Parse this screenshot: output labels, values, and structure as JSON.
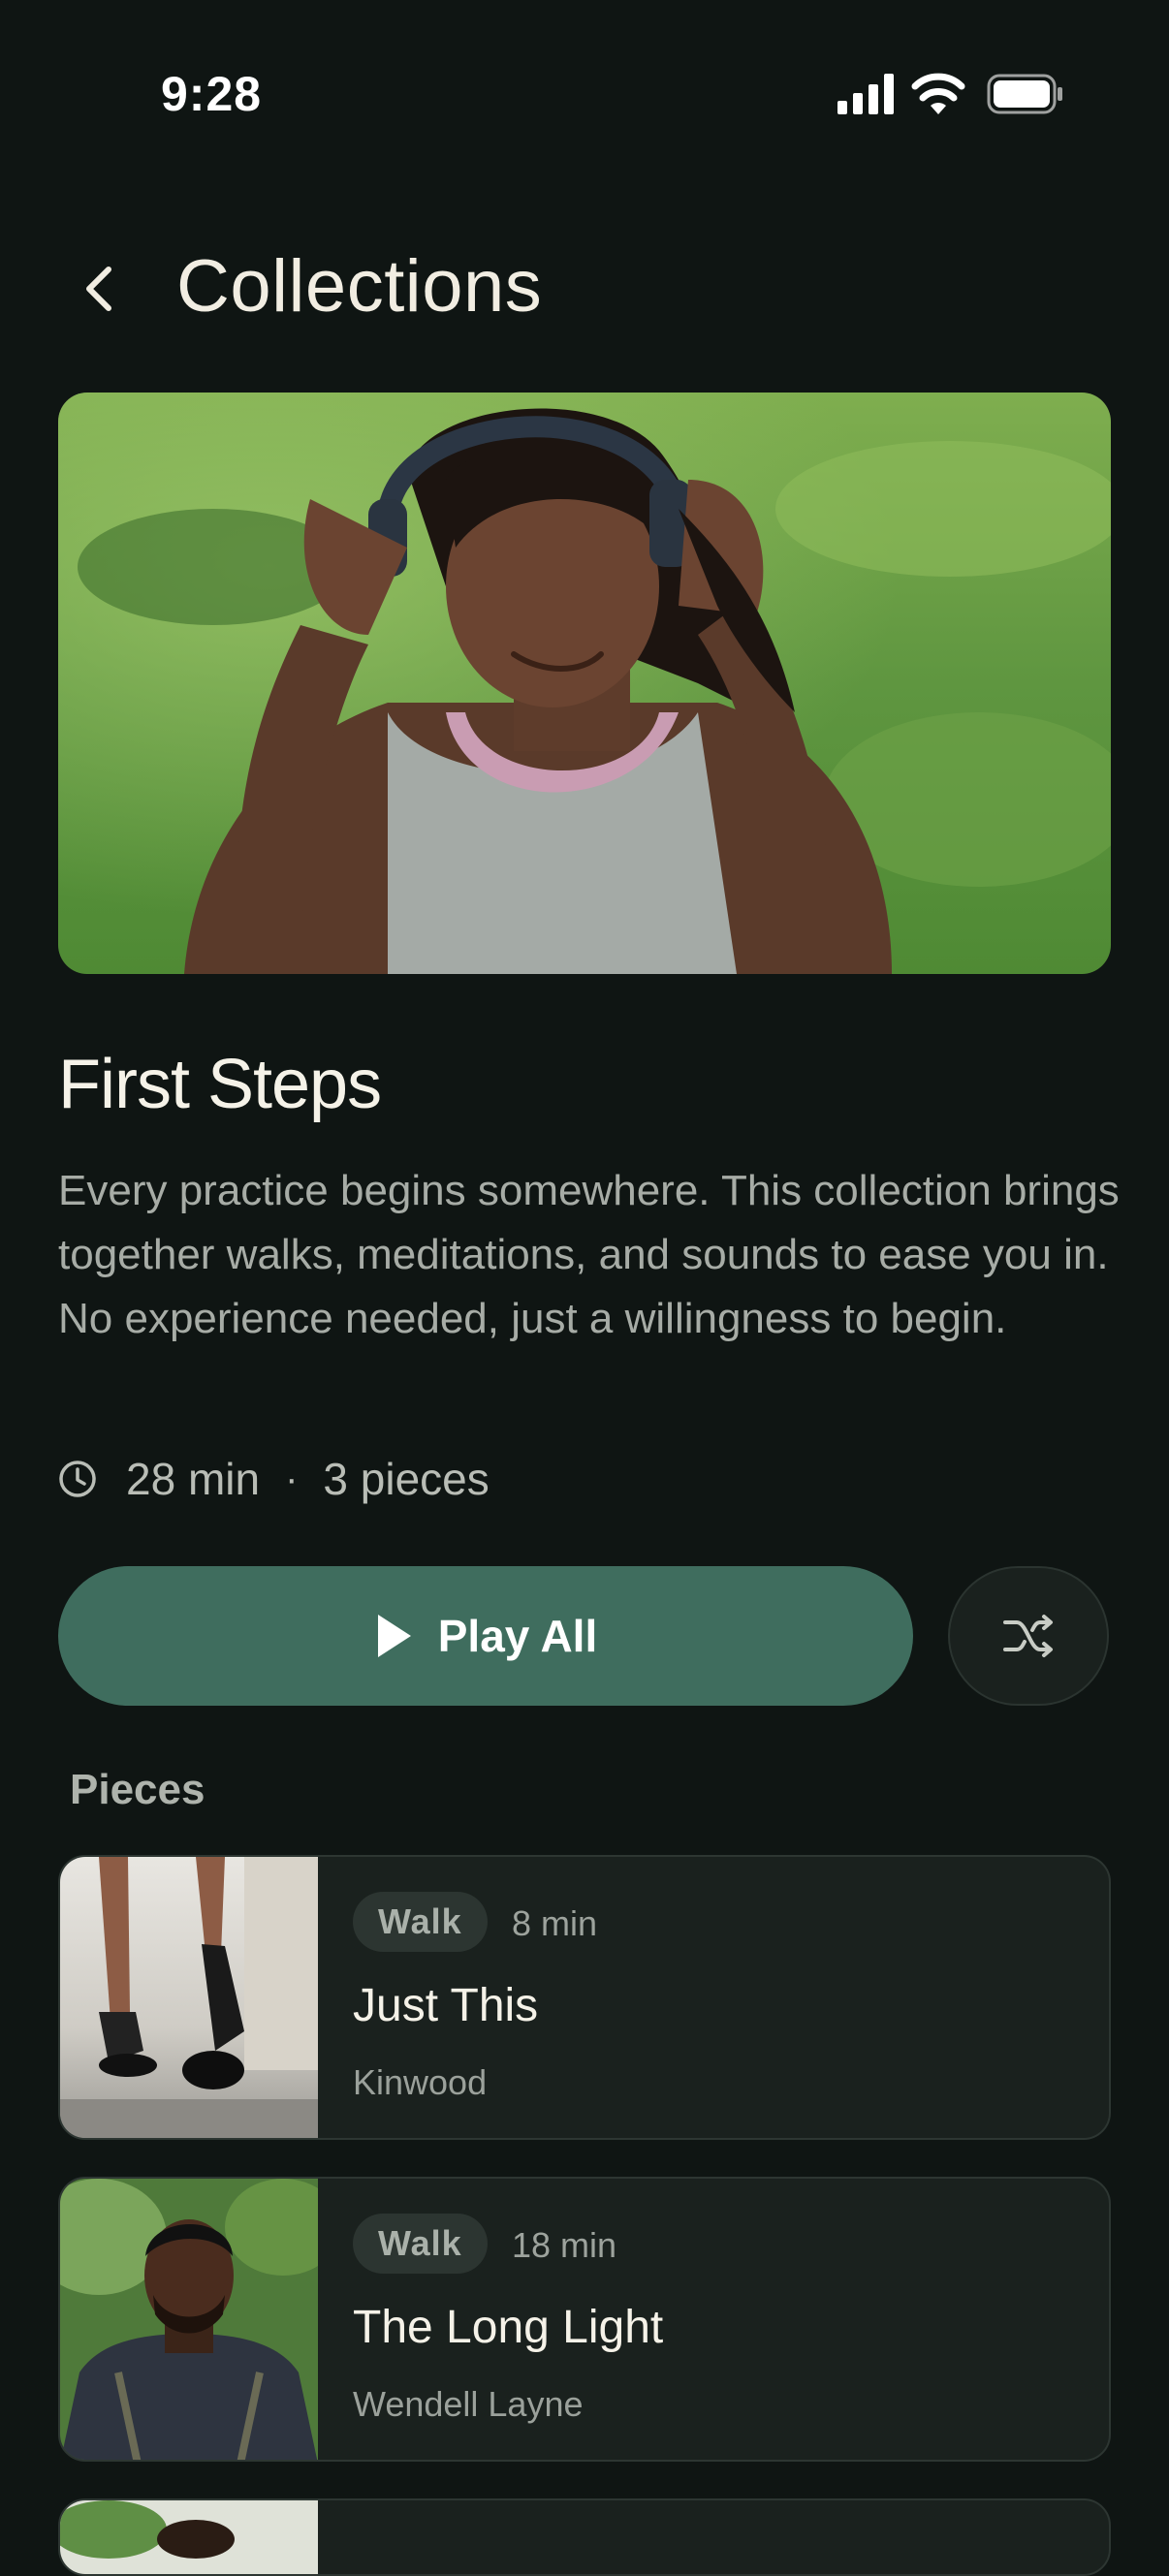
{
  "status": {
    "time": "9:28"
  },
  "header": {
    "title": "Collections"
  },
  "collection": {
    "title": "First Steps",
    "description": "Every practice begins somewhere. This collection brings together walks, meditations, and sounds to ease you in. No experience needed, just a willingness to begin.",
    "duration": "28 min",
    "separator": "·",
    "count": "3 pieces"
  },
  "actions": {
    "play_all": "Play All"
  },
  "pieces_label": "Pieces",
  "pieces": [
    {
      "tag": "Walk",
      "duration": "8 min",
      "title": "Just This",
      "artist": "Kinwood"
    },
    {
      "tag": "Walk",
      "duration": "18 min",
      "title": "The Long Light",
      "artist": "Wendell Layne"
    }
  ],
  "colors": {
    "background": "#0f1513",
    "accent": "#3f6d5e",
    "card": "#1a211e"
  }
}
